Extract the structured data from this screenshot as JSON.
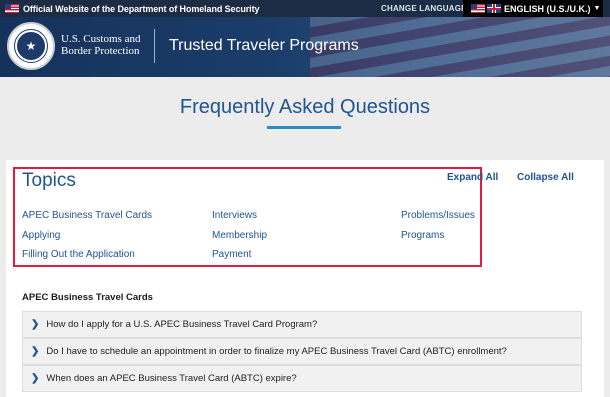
{
  "gov_banner": {
    "official_text": "Official Website of the Department of Homeland Security",
    "change_language_label": "CHANGE LANGUAGE:",
    "language_selected": "ENGLISH (U.S./U.K.)"
  },
  "header": {
    "agency_line1": "U.S. Customs and",
    "agency_line2": "Border Protection",
    "program_title": "Trusted Traveler Programs"
  },
  "page": {
    "title": "Frequently Asked Questions"
  },
  "topics": {
    "heading": "Topics",
    "expand_all": "Expand All",
    "collapse_all": "Collapse All",
    "links": [
      "APEC Business Travel Cards",
      "Applying",
      "Filling Out the Application",
      "Interviews",
      "Membership",
      "Payment",
      "Problems/Issues",
      "Programs"
    ]
  },
  "sections": [
    {
      "heading": "APEC Business Travel Cards",
      "questions": [
        "How do I apply for a U.S. APEC Business Travel Card Program?",
        "Do I have to schedule an appointment in order to finalize my APEC Business Travel Card (ABTC) enrollment?",
        "When does an APEC Business Travel Card (ABTC) expire?"
      ]
    }
  ],
  "colors": {
    "brand_blue": "#205493",
    "banner_navy": "#1b2c44",
    "highlight_red": "#e31c3d",
    "underline_blue": "#2e8bc0"
  },
  "icons": {
    "faq_item": "chevron-right-icon",
    "seal": "dhs-seal-icon",
    "language_caret": "caret-down-icon"
  }
}
